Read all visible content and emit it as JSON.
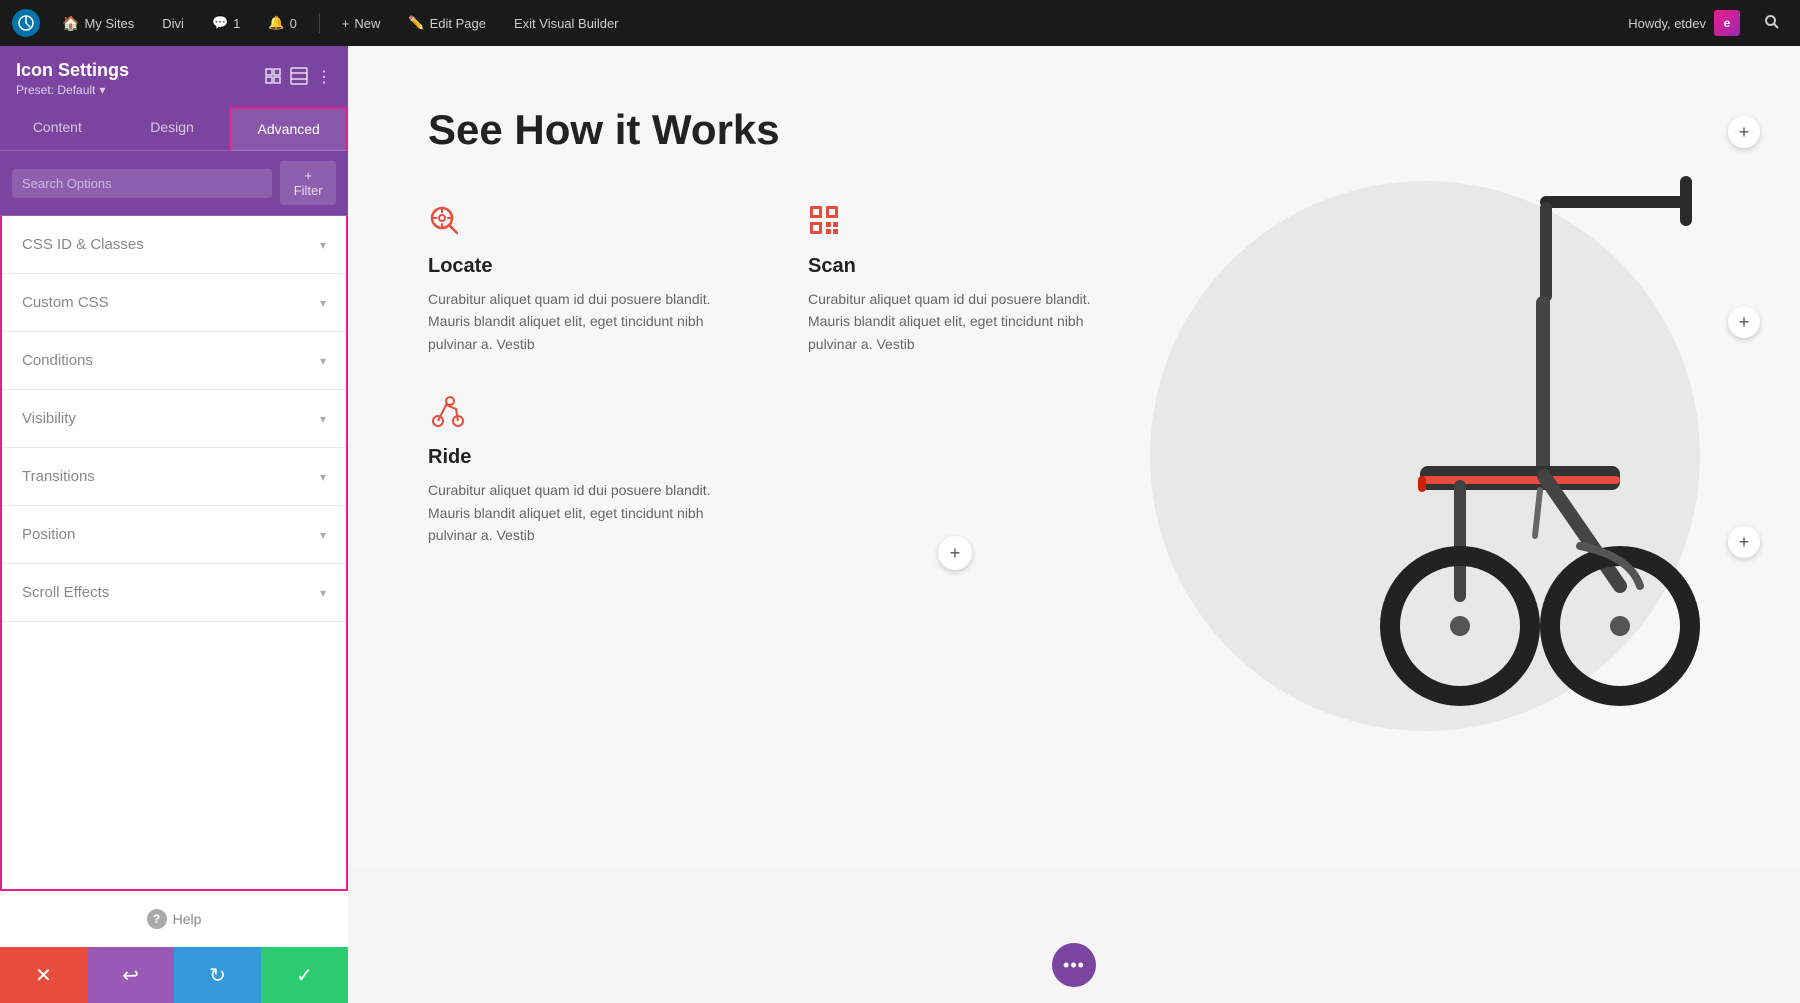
{
  "adminBar": {
    "wpLogo": "W",
    "items": [
      {
        "label": "My Sites",
        "icon": "🏠"
      },
      {
        "label": "Divi",
        "icon": "D"
      },
      {
        "label": "1",
        "icon": "💬"
      },
      {
        "label": "0",
        "icon": "🔔"
      },
      {
        "label": "New",
        "icon": "+"
      },
      {
        "label": "Edit Page",
        "icon": "✏️"
      },
      {
        "label": "Exit Visual Builder",
        "icon": ""
      }
    ],
    "howdy": "Howdy, etdev",
    "avatarText": "e"
  },
  "panel": {
    "title": "Icon Settings",
    "preset": "Preset: Default",
    "tabs": [
      {
        "label": "Content",
        "id": "content"
      },
      {
        "label": "Design",
        "id": "design"
      },
      {
        "label": "Advanced",
        "id": "advanced"
      }
    ],
    "activeTab": "advanced",
    "search": {
      "placeholder": "Search Options",
      "filterLabel": "+ Filter"
    },
    "accordion": [
      {
        "label": "CSS ID & Classes",
        "expanded": false
      },
      {
        "label": "Custom CSS",
        "expanded": false
      },
      {
        "label": "Conditions",
        "expanded": false
      },
      {
        "label": "Visibility",
        "expanded": false
      },
      {
        "label": "Transitions",
        "expanded": false
      },
      {
        "label": "Position",
        "expanded": false
      },
      {
        "label": "Scroll Effects",
        "expanded": false
      }
    ],
    "help": "Help",
    "bottomButtons": [
      {
        "label": "✕",
        "action": "cancel"
      },
      {
        "label": "↩",
        "action": "undo"
      },
      {
        "label": "↻",
        "action": "redo"
      },
      {
        "label": "✓",
        "action": "save"
      }
    ]
  },
  "page": {
    "title": "See How it Works",
    "features": [
      {
        "id": "locate",
        "title": "Locate",
        "text": "Curabitur aliquet quam id dui posuere blandit. Mauris blandit aliquet elit, eget tincidunt nibh pulvinar a. Vestib",
        "icon": "🔍"
      },
      {
        "id": "scan",
        "title": "Scan",
        "text": "Curabitur aliquet quam id dui posuere blandit. Mauris blandit aliquet elit, eget tincidunt nibh pulvinar a. Vestib",
        "icon": "qr"
      },
      {
        "id": "ride",
        "title": "Ride",
        "text": "Curabitur aliquet quam id dui posuere blandit. Mauris blandit aliquet elit, eget tincidunt nibh pulvinar a. Vestib",
        "icon": "ride"
      }
    ],
    "dotsMenu": "•••"
  }
}
